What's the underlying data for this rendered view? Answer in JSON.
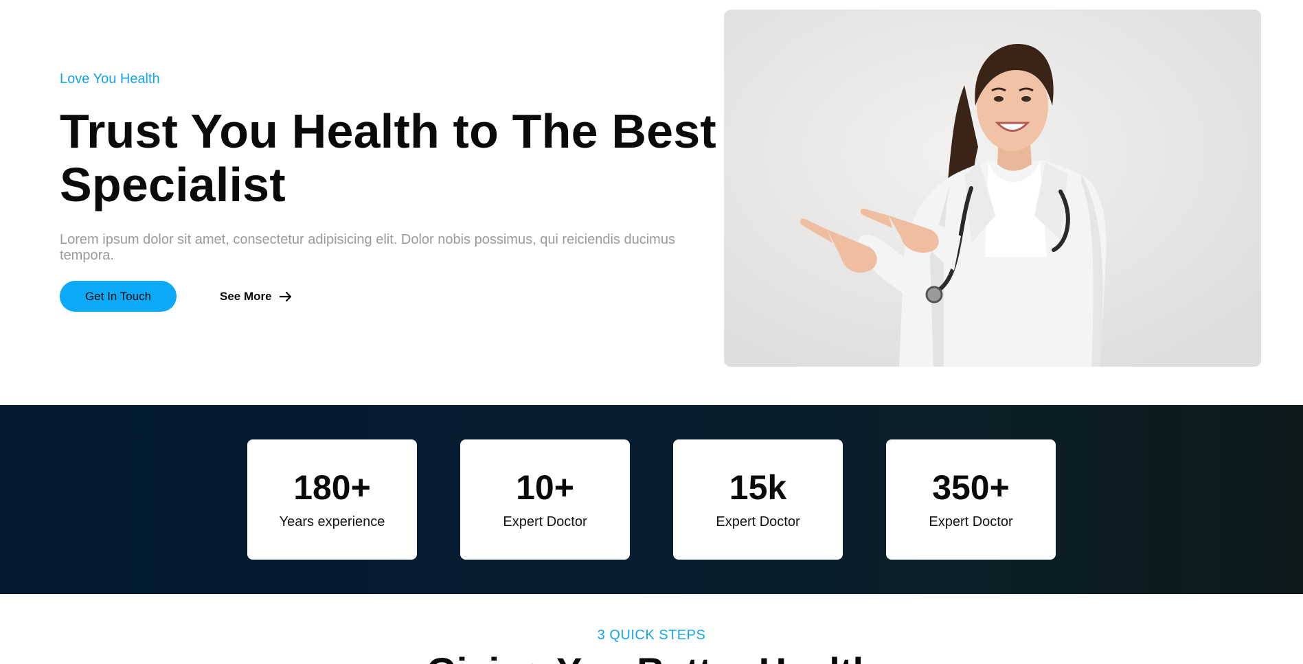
{
  "hero": {
    "eyebrow": "Love You Health",
    "title": "Trust You Health to The Best Specialist",
    "description": "Lorem ipsum dolor sit amet, consectetur adipisicing elit. Dolor nobis possimus, qui reiciendis ducimus tempora.",
    "primary_button": "Get In Touch",
    "secondary_button": "See More",
    "secondary_icon": "arrow-right-icon",
    "image_subject": "doctor-pointing-photo"
  },
  "stats": [
    {
      "value": "180+",
      "label": "Years experience"
    },
    {
      "value": "10+",
      "label": "Expert Doctor"
    },
    {
      "value": "15k",
      "label": "Expert Doctor"
    },
    {
      "value": "350+",
      "label": "Expert Doctor"
    }
  ],
  "steps": {
    "eyebrow": "3 QUICK STEPS",
    "title": "Giving You Better Health"
  },
  "colors": {
    "accent": "#0aaaf6",
    "eyebrow": "#13a4ec",
    "band_dark": "#041b30"
  }
}
